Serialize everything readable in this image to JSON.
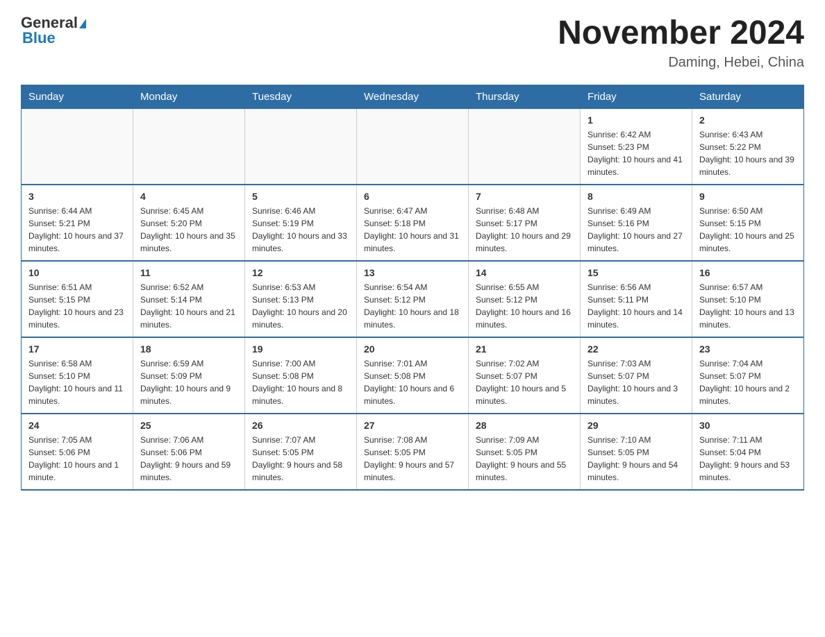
{
  "header": {
    "logo_general": "General",
    "logo_blue": "Blue",
    "month_title": "November 2024",
    "location": "Daming, Hebei, China"
  },
  "days_of_week": [
    "Sunday",
    "Monday",
    "Tuesday",
    "Wednesday",
    "Thursday",
    "Friday",
    "Saturday"
  ],
  "weeks": [
    [
      {
        "day": "",
        "info": ""
      },
      {
        "day": "",
        "info": ""
      },
      {
        "day": "",
        "info": ""
      },
      {
        "day": "",
        "info": ""
      },
      {
        "day": "",
        "info": ""
      },
      {
        "day": "1",
        "info": "Sunrise: 6:42 AM\nSunset: 5:23 PM\nDaylight: 10 hours and 41 minutes."
      },
      {
        "day": "2",
        "info": "Sunrise: 6:43 AM\nSunset: 5:22 PM\nDaylight: 10 hours and 39 minutes."
      }
    ],
    [
      {
        "day": "3",
        "info": "Sunrise: 6:44 AM\nSunset: 5:21 PM\nDaylight: 10 hours and 37 minutes."
      },
      {
        "day": "4",
        "info": "Sunrise: 6:45 AM\nSunset: 5:20 PM\nDaylight: 10 hours and 35 minutes."
      },
      {
        "day": "5",
        "info": "Sunrise: 6:46 AM\nSunset: 5:19 PM\nDaylight: 10 hours and 33 minutes."
      },
      {
        "day": "6",
        "info": "Sunrise: 6:47 AM\nSunset: 5:18 PM\nDaylight: 10 hours and 31 minutes."
      },
      {
        "day": "7",
        "info": "Sunrise: 6:48 AM\nSunset: 5:17 PM\nDaylight: 10 hours and 29 minutes."
      },
      {
        "day": "8",
        "info": "Sunrise: 6:49 AM\nSunset: 5:16 PM\nDaylight: 10 hours and 27 minutes."
      },
      {
        "day": "9",
        "info": "Sunrise: 6:50 AM\nSunset: 5:15 PM\nDaylight: 10 hours and 25 minutes."
      }
    ],
    [
      {
        "day": "10",
        "info": "Sunrise: 6:51 AM\nSunset: 5:15 PM\nDaylight: 10 hours and 23 minutes."
      },
      {
        "day": "11",
        "info": "Sunrise: 6:52 AM\nSunset: 5:14 PM\nDaylight: 10 hours and 21 minutes."
      },
      {
        "day": "12",
        "info": "Sunrise: 6:53 AM\nSunset: 5:13 PM\nDaylight: 10 hours and 20 minutes."
      },
      {
        "day": "13",
        "info": "Sunrise: 6:54 AM\nSunset: 5:12 PM\nDaylight: 10 hours and 18 minutes."
      },
      {
        "day": "14",
        "info": "Sunrise: 6:55 AM\nSunset: 5:12 PM\nDaylight: 10 hours and 16 minutes."
      },
      {
        "day": "15",
        "info": "Sunrise: 6:56 AM\nSunset: 5:11 PM\nDaylight: 10 hours and 14 minutes."
      },
      {
        "day": "16",
        "info": "Sunrise: 6:57 AM\nSunset: 5:10 PM\nDaylight: 10 hours and 13 minutes."
      }
    ],
    [
      {
        "day": "17",
        "info": "Sunrise: 6:58 AM\nSunset: 5:10 PM\nDaylight: 10 hours and 11 minutes."
      },
      {
        "day": "18",
        "info": "Sunrise: 6:59 AM\nSunset: 5:09 PM\nDaylight: 10 hours and 9 minutes."
      },
      {
        "day": "19",
        "info": "Sunrise: 7:00 AM\nSunset: 5:08 PM\nDaylight: 10 hours and 8 minutes."
      },
      {
        "day": "20",
        "info": "Sunrise: 7:01 AM\nSunset: 5:08 PM\nDaylight: 10 hours and 6 minutes."
      },
      {
        "day": "21",
        "info": "Sunrise: 7:02 AM\nSunset: 5:07 PM\nDaylight: 10 hours and 5 minutes."
      },
      {
        "day": "22",
        "info": "Sunrise: 7:03 AM\nSunset: 5:07 PM\nDaylight: 10 hours and 3 minutes."
      },
      {
        "day": "23",
        "info": "Sunrise: 7:04 AM\nSunset: 5:07 PM\nDaylight: 10 hours and 2 minutes."
      }
    ],
    [
      {
        "day": "24",
        "info": "Sunrise: 7:05 AM\nSunset: 5:06 PM\nDaylight: 10 hours and 1 minute."
      },
      {
        "day": "25",
        "info": "Sunrise: 7:06 AM\nSunset: 5:06 PM\nDaylight: 9 hours and 59 minutes."
      },
      {
        "day": "26",
        "info": "Sunrise: 7:07 AM\nSunset: 5:05 PM\nDaylight: 9 hours and 58 minutes."
      },
      {
        "day": "27",
        "info": "Sunrise: 7:08 AM\nSunset: 5:05 PM\nDaylight: 9 hours and 57 minutes."
      },
      {
        "day": "28",
        "info": "Sunrise: 7:09 AM\nSunset: 5:05 PM\nDaylight: 9 hours and 55 minutes."
      },
      {
        "day": "29",
        "info": "Sunrise: 7:10 AM\nSunset: 5:05 PM\nDaylight: 9 hours and 54 minutes."
      },
      {
        "day": "30",
        "info": "Sunrise: 7:11 AM\nSunset: 5:04 PM\nDaylight: 9 hours and 53 minutes."
      }
    ]
  ]
}
